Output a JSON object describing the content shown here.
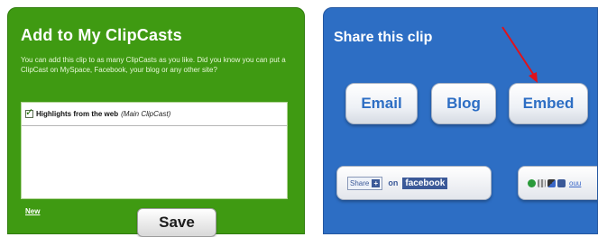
{
  "add_panel": {
    "title": "Add to My ClipCasts",
    "description": "You can add this clip to as many ClipCasts as you like. Did you know you can put a ClipCast on MySpace, Facebook, your blog or any other site?",
    "items": [
      {
        "label": "Highlights from the web",
        "tag": "(Main ClipCast)",
        "checked": true
      }
    ],
    "new_link": "New",
    "save_label": "Save",
    "panel_color": "#3f9a12"
  },
  "share_panel": {
    "title": "Share this clip",
    "buttons": {
      "email": "Email",
      "blog": "Blog",
      "embed": "Embed"
    },
    "facebook": {
      "share_label": "Share",
      "plus": "+",
      "on": "on",
      "brand": "facebook"
    },
    "bookmark_text": "ouu",
    "panel_color": "#2d6ec4",
    "arrow_color": "#e0121b"
  }
}
